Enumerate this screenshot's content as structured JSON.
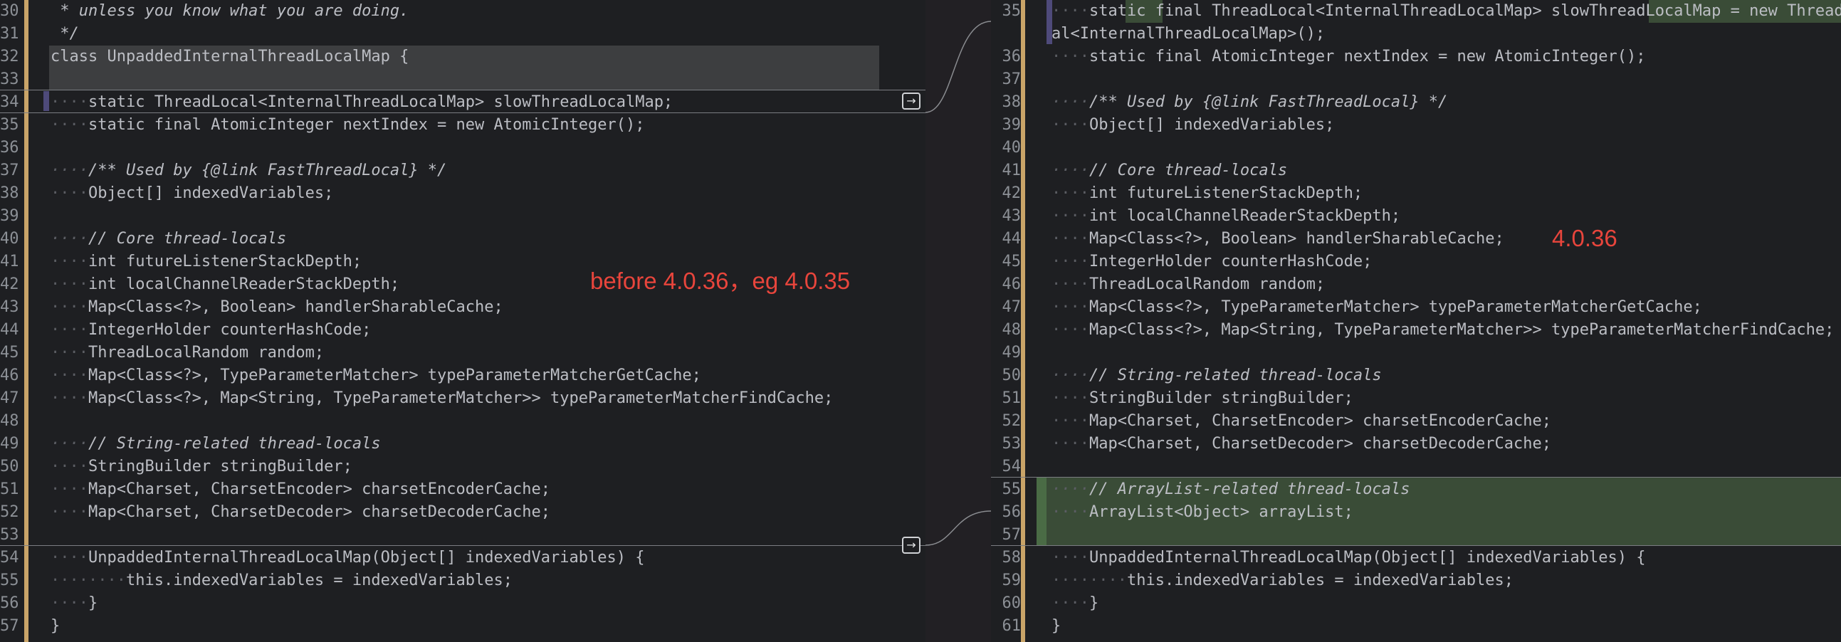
{
  "left": {
    "lines": [
      {
        "num": "30",
        "indent": " ",
        "code": "* unless you know what you are doing.",
        "type": "comment"
      },
      {
        "num": "31",
        "indent": " ",
        "code": "*/",
        "type": "comment"
      },
      {
        "num": "32",
        "indent": "",
        "code": "class UnpaddedInternalThreadLocalMap {",
        "type": "code"
      },
      {
        "num": "33",
        "indent": "",
        "code": "",
        "type": "code"
      },
      {
        "num": "34",
        "indent": "····",
        "code": "static ThreadLocal<InternalThreadLocalMap> slowThreadLocalMap;",
        "type": "code"
      },
      {
        "num": "35",
        "indent": "····",
        "code": "static final AtomicInteger nextIndex = new AtomicInteger();",
        "type": "code"
      },
      {
        "num": "36",
        "indent": "",
        "code": "",
        "type": "code"
      },
      {
        "num": "37",
        "indent": "····",
        "code": "/** Used by {@link FastThreadLocal} */",
        "type": "comment"
      },
      {
        "num": "38",
        "indent": "····",
        "code": "Object[] indexedVariables;",
        "type": "code"
      },
      {
        "num": "39",
        "indent": "",
        "code": "",
        "type": "code"
      },
      {
        "num": "40",
        "indent": "····",
        "code": "// Core thread-locals",
        "type": "comment"
      },
      {
        "num": "41",
        "indent": "····",
        "code": "int futureListenerStackDepth;",
        "type": "code"
      },
      {
        "num": "42",
        "indent": "····",
        "code": "int localChannelReaderStackDepth;",
        "type": "code"
      },
      {
        "num": "43",
        "indent": "····",
        "code": "Map<Class<?>, Boolean> handlerSharableCache;",
        "type": "code"
      },
      {
        "num": "44",
        "indent": "····",
        "code": "IntegerHolder counterHashCode;",
        "type": "code"
      },
      {
        "num": "45",
        "indent": "····",
        "code": "ThreadLocalRandom random;",
        "type": "code"
      },
      {
        "num": "46",
        "indent": "····",
        "code": "Map<Class<?>, TypeParameterMatcher> typeParameterMatcherGetCache;",
        "type": "code"
      },
      {
        "num": "47",
        "indent": "····",
        "code": "Map<Class<?>, Map<String, TypeParameterMatcher>> typeParameterMatcherFindCache;",
        "type": "code"
      },
      {
        "num": "48",
        "indent": "",
        "code": "",
        "type": "code"
      },
      {
        "num": "49",
        "indent": "····",
        "code": "// String-related thread-locals",
        "type": "comment"
      },
      {
        "num": "50",
        "indent": "····",
        "code": "StringBuilder stringBuilder;",
        "type": "code"
      },
      {
        "num": "51",
        "indent": "····",
        "code": "Map<Charset, CharsetEncoder> charsetEncoderCache;",
        "type": "code"
      },
      {
        "num": "52",
        "indent": "····",
        "code": "Map<Charset, CharsetDecoder> charsetDecoderCache;",
        "type": "code"
      },
      {
        "num": "53",
        "indent": "",
        "code": "",
        "type": "code"
      },
      {
        "num": "54",
        "indent": "····",
        "code": "UnpaddedInternalThreadLocalMap(Object[] indexedVariables) {",
        "type": "code"
      },
      {
        "num": "55",
        "indent": "········",
        "code": "this.indexedVariables = indexedVariables;",
        "type": "code"
      },
      {
        "num": "56",
        "indent": "····",
        "code": "}",
        "type": "code"
      },
      {
        "num": "57",
        "indent": "",
        "code": "}",
        "type": "code"
      }
    ],
    "annotation": "before 4.0.36，eg 4.0.35"
  },
  "right": {
    "lines": [
      {
        "num": "35",
        "indent": "····",
        "code": "static final ThreadLocal<InternalThreadLocalMap> slowThreadLocalMap = new Thread",
        "type": "code"
      },
      {
        "num": "",
        "indent": "",
        "code": "al<InternalThreadLocalMap>();",
        "type": "code"
      },
      {
        "num": "36",
        "indent": "····",
        "code": "static final AtomicInteger nextIndex = new AtomicInteger();",
        "type": "code"
      },
      {
        "num": "37",
        "indent": "",
        "code": "",
        "type": "code"
      },
      {
        "num": "38",
        "indent": "····",
        "code": "/** Used by {@link FastThreadLocal} */",
        "type": "comment"
      },
      {
        "num": "39",
        "indent": "····",
        "code": "Object[] indexedVariables;",
        "type": "code"
      },
      {
        "num": "40",
        "indent": "",
        "code": "",
        "type": "code"
      },
      {
        "num": "41",
        "indent": "····",
        "code": "// Core thread-locals",
        "type": "comment"
      },
      {
        "num": "42",
        "indent": "····",
        "code": "int futureListenerStackDepth;",
        "type": "code"
      },
      {
        "num": "43",
        "indent": "····",
        "code": "int localChannelReaderStackDepth;",
        "type": "code"
      },
      {
        "num": "44",
        "indent": "····",
        "code": "Map<Class<?>, Boolean> handlerSharableCache;",
        "type": "code"
      },
      {
        "num": "45",
        "indent": "····",
        "code": "IntegerHolder counterHashCode;",
        "type": "code"
      },
      {
        "num": "46",
        "indent": "····",
        "code": "ThreadLocalRandom random;",
        "type": "code"
      },
      {
        "num": "47",
        "indent": "····",
        "code": "Map<Class<?>, TypeParameterMatcher> typeParameterMatcherGetCache;",
        "type": "code"
      },
      {
        "num": "48",
        "indent": "····",
        "code": "Map<Class<?>, Map<String, TypeParameterMatcher>> typeParameterMatcherFindCache;",
        "type": "code"
      },
      {
        "num": "49",
        "indent": "",
        "code": "",
        "type": "code"
      },
      {
        "num": "50",
        "indent": "····",
        "code": "// String-related thread-locals",
        "type": "comment"
      },
      {
        "num": "51",
        "indent": "····",
        "code": "StringBuilder stringBuilder;",
        "type": "code"
      },
      {
        "num": "52",
        "indent": "····",
        "code": "Map<Charset, CharsetEncoder> charsetEncoderCache;",
        "type": "code"
      },
      {
        "num": "53",
        "indent": "····",
        "code": "Map<Charset, CharsetDecoder> charsetDecoderCache;",
        "type": "code"
      },
      {
        "num": "54",
        "indent": "",
        "code": "",
        "type": "code"
      },
      {
        "num": "55",
        "indent": "····",
        "code": "// ArrayList-related thread-locals",
        "type": "comment"
      },
      {
        "num": "56",
        "indent": "····",
        "code": "ArrayList<Object> arrayList;",
        "type": "code"
      },
      {
        "num": "57",
        "indent": "",
        "code": "",
        "type": "code"
      },
      {
        "num": "58",
        "indent": "····",
        "code": "UnpaddedInternalThreadLocalMap(Object[] indexedVariables) {",
        "type": "code"
      },
      {
        "num": "59",
        "indent": "········",
        "code": "this.indexedVariables = indexedVariables;",
        "type": "code"
      },
      {
        "num": "60",
        "indent": "····",
        "code": "}",
        "type": "code"
      },
      {
        "num": "61",
        "indent": "",
        "code": "}",
        "type": "code"
      }
    ],
    "annotation": "4.0.36"
  },
  "actions": {
    "apply_change_1": "→",
    "apply_change_2": "→"
  },
  "colors": {
    "background": "#1e1f22",
    "change_bar": "#c9a468",
    "added_highlight": "#3a4c37",
    "annotation": "#e8453c"
  }
}
